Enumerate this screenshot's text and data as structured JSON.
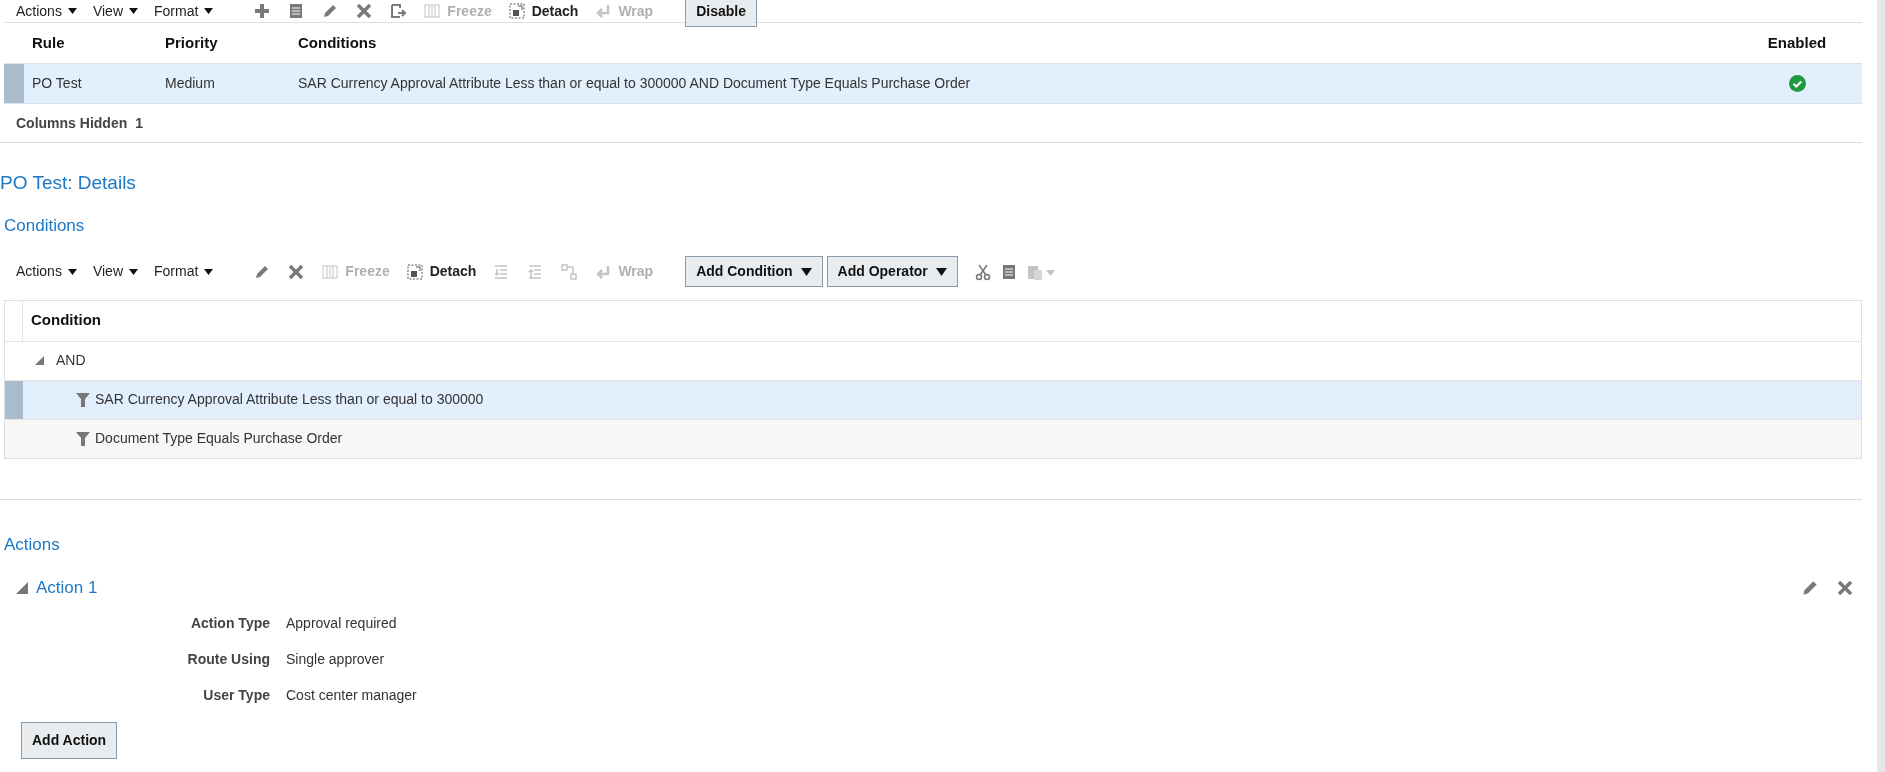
{
  "rules_toolbar": {
    "menus": [
      "Actions",
      "View",
      "Format"
    ],
    "tools": [
      {
        "kind": "icon",
        "disabled": false
      },
      {
        "kind": "icon",
        "disabled": false
      },
      {
        "kind": "icon",
        "disabled": false
      },
      {
        "kind": "icon",
        "disabled": false
      },
      {
        "kind": "icon",
        "disabled": false
      },
      {
        "kind": "text",
        "label": "Freeze",
        "disabled": true
      },
      {
        "kind": "text",
        "label": "Detach",
        "disabled": false
      },
      {
        "kind": "text",
        "label": "Wrap",
        "disabled": true
      }
    ],
    "buttons": [
      "Disable"
    ]
  },
  "rules_table": {
    "columns": [
      "Rule",
      "Priority",
      "Conditions",
      "Enabled"
    ],
    "rows": [
      {
        "selected": true,
        "rule": "PO Test",
        "priority": "Medium",
        "conditions": "SAR Currency Approval Attribute Less than or equal to 300000 AND Document Type Equals Purchase Order",
        "enabled": true
      }
    ],
    "columns_hidden_label": "Columns Hidden",
    "columns_hidden_count": "1"
  },
  "details_title": "PO Test: Details",
  "conditions": {
    "title": "Conditions",
    "menus": [
      "Actions",
      "View",
      "Format"
    ],
    "tools": [
      {
        "kind": "icon",
        "disabled": false
      },
      {
        "kind": "icon",
        "disabled": false
      },
      {
        "kind": "text",
        "label": "Freeze",
        "disabled": true
      },
      {
        "kind": "text",
        "label": "Detach",
        "disabled": false
      },
      {
        "kind": "icon",
        "disabled": true
      },
      {
        "kind": "icon",
        "disabled": true
      },
      {
        "kind": "icon",
        "disabled": true
      },
      {
        "kind": "text",
        "label": "Wrap",
        "disabled": true
      }
    ],
    "buttons": [
      "Add Condition",
      "Add Operator"
    ],
    "column": "Condition",
    "tree": [
      {
        "label": "AND",
        "kind": "operator",
        "expanded": true,
        "selected": false,
        "children": [
          {
            "label": "SAR Currency Approval Attribute Less than or equal to 300000",
            "kind": "condition",
            "selected": true
          },
          {
            "label": "Document Type Equals Purchase Order",
            "kind": "condition",
            "selected": false
          }
        ]
      }
    ]
  },
  "actions": {
    "title": "Actions",
    "items": [
      {
        "title": "Action 1",
        "expanded": true,
        "fields": [
          {
            "label": "Action Type",
            "value": "Approval required"
          },
          {
            "label": "Route Using",
            "value": "Single approver"
          },
          {
            "label": "User Type",
            "value": "Cost center manager"
          }
        ]
      }
    ],
    "add_button": "Add Action"
  }
}
